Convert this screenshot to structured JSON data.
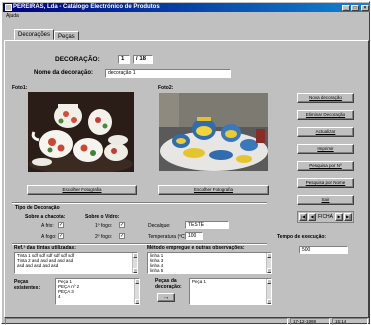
{
  "window": {
    "title": "PEREIRAS, Lda - Catálogo Electrónico de Produtos"
  },
  "menu": {
    "items": [
      "Ajuda"
    ]
  },
  "tabs": [
    {
      "label": "Decorações"
    },
    {
      "label": "Peças"
    }
  ],
  "form": {
    "decoracao_label": "DECORAÇÃO:",
    "record_index": "1",
    "record_total": "18",
    "nome_label": "Nome da decoração:",
    "nome_value": "decoração 1",
    "foto1_label": "Foto1:",
    "foto2_label": "Foto2:",
    "escolher1": "Escolher Fotografia",
    "escolher2": "Escolher Fotografia",
    "tipo_label": "Tipo de Decoração",
    "sobre_chacota_label": "Sobre a chacota:",
    "sobre_vidro_label": "Sobre o Vidro:",
    "chacota_a_frio": "A frio:",
    "chacota_a_fogo": "A fogo:",
    "vidro_1o_fogo": "1º fogo:",
    "vidro_2o_fogo": "2º fogo:",
    "chacota_a_frio_checked": true,
    "chacota_a_fogo_checked": true,
    "vidro_1o_fogo_checked": true,
    "vidro_2o_fogo_checked": true,
    "check_mark": "✓",
    "decalque_label": "Decalque:",
    "decalque_value": "TESTE",
    "temperatura_label": "Temperatura (ºC):",
    "temperatura_value": "100",
    "tempo_label": "Tempo de execução:",
    "tempo_value": "500",
    "tintas_label": "Ref.ª das tintas utilizadas:",
    "tintas_lines": [
      "Tinta 1 sdf sdf sdf sdf sdf sdf",
      "Tinta 2 asd asd asd asd asd",
      "asd asd asd asd asd"
    ],
    "metodo_label": "Método empregue e outras observações:",
    "metodo_lines": [
      "linha 1",
      "linha 3",
      "linha 4",
      "linha 5"
    ],
    "pecas_existentes_label": "Peças existentes:",
    "pecas_existentes": [
      "Peça 1",
      "PEÇA nº 2",
      "PEÇA 3",
      "4"
    ],
    "pecas_decoracao_label": "Peças da decoração:",
    "pecas_decoracao": [
      "Peça 1"
    ],
    "transfer_arrow": "→"
  },
  "sidebar": {
    "buttons": [
      "Nova decoração",
      "Eliminar Decoração",
      "Actualizar",
      "Imprimir",
      "Pesquisa por Nº",
      "Pesquisa por Nome",
      "Sair"
    ]
  },
  "navigator": {
    "first": "|◀",
    "prev": "◀",
    "label": "FICHA",
    "next": "▶",
    "last": "▶|"
  },
  "status": {
    "date": "17-12-1999",
    "time": "15:14"
  },
  "titlebar_buttons": {
    "minimize": "_",
    "maximize": "□",
    "close": "×"
  },
  "scroll_arrows": {
    "up": "▲",
    "down": "▼"
  },
  "colors": {
    "title_start": "#00007b",
    "title_end": "#1084d0",
    "face": "#c0c0c0"
  }
}
